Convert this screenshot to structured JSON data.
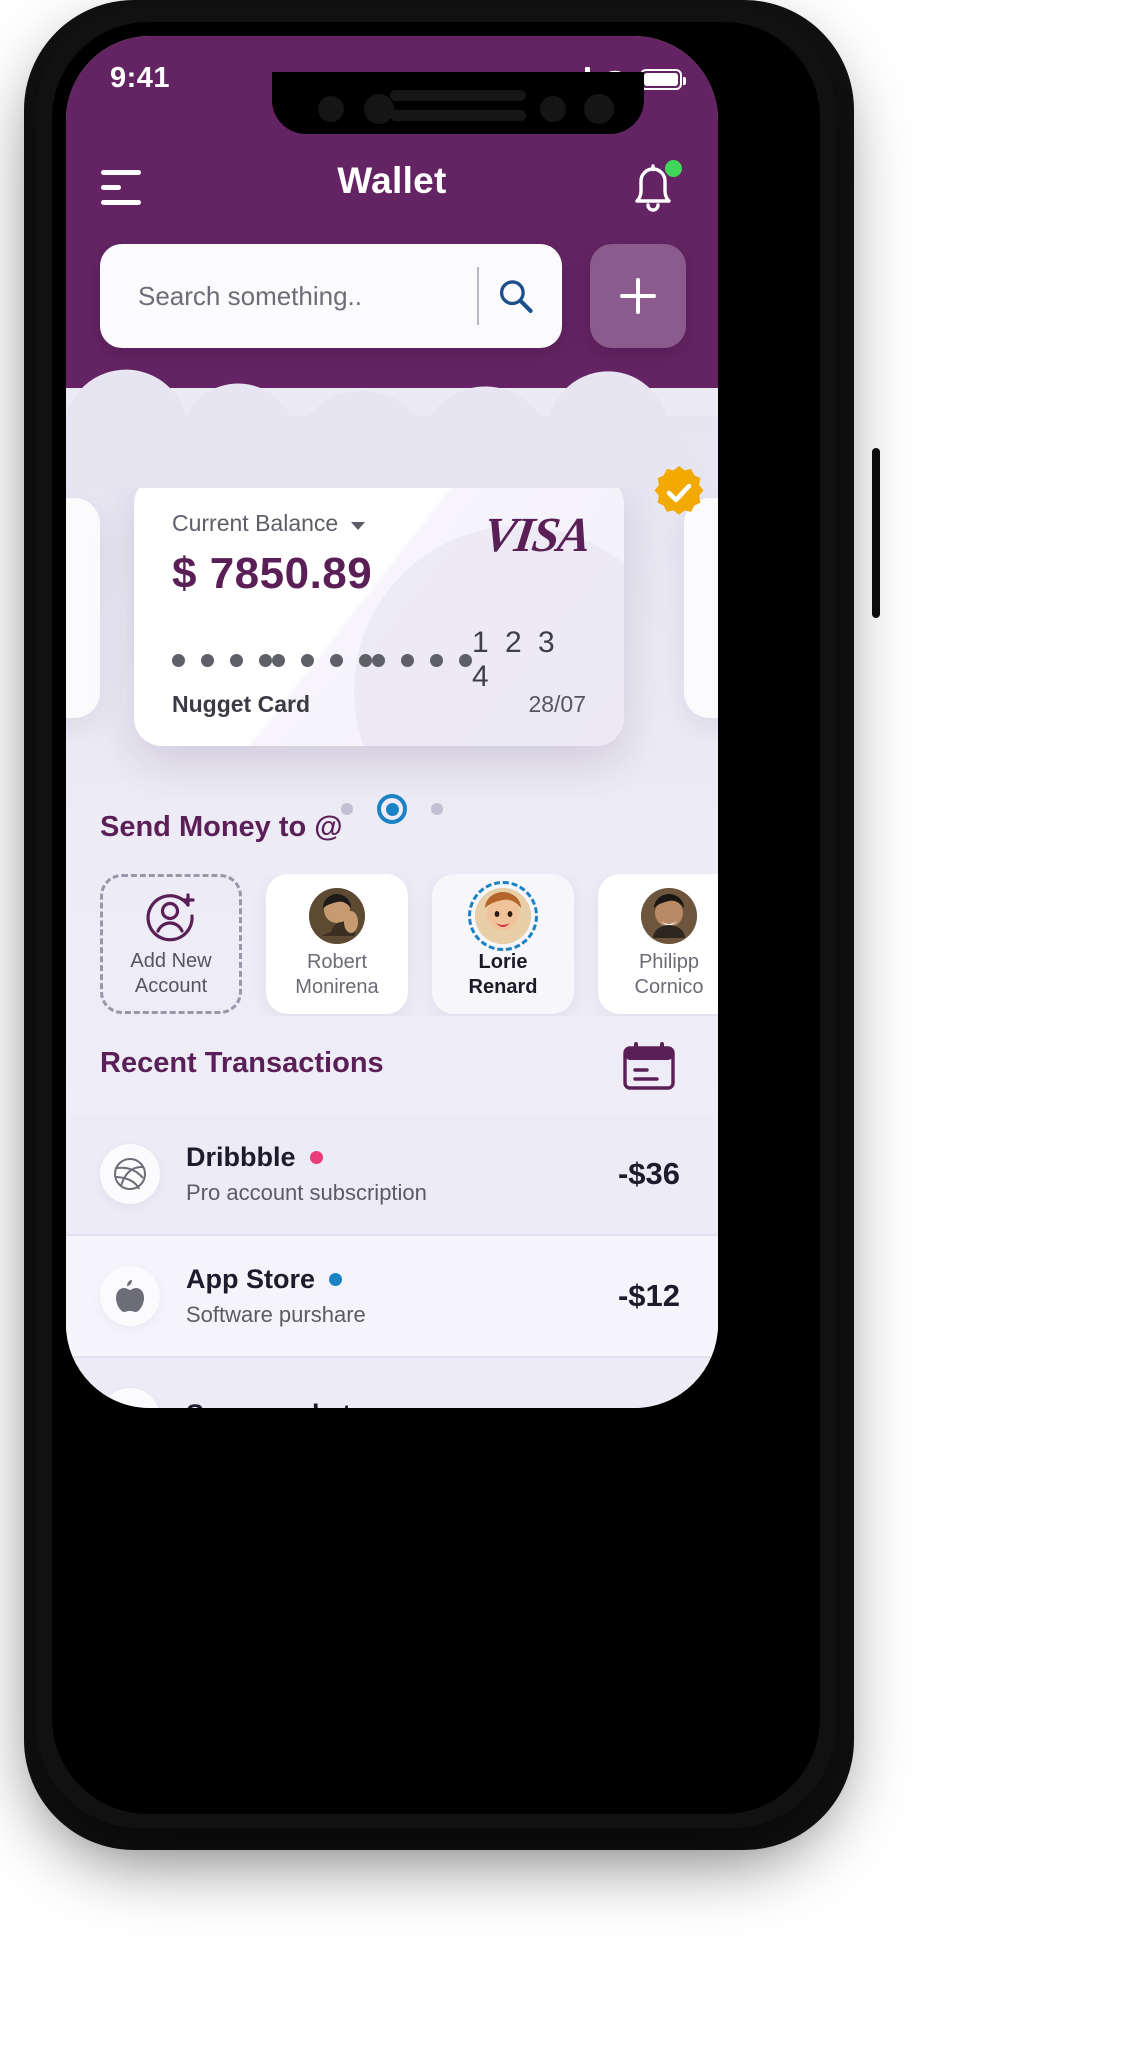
{
  "status_bar": {
    "time": "9:41",
    "signal_icon": "signal-bars-icon",
    "wifi_icon": "wifi-icon",
    "battery_icon": "battery-full-icon"
  },
  "nav": {
    "menu_icon": "hamburger-menu-icon",
    "title": "Wallet",
    "bell_icon": "notification-bell-icon",
    "has_notification": true,
    "notification_color": "#3fd659"
  },
  "search": {
    "placeholder": "Search something..",
    "value": "",
    "icon": "search-magnifier-icon"
  },
  "add_button": {
    "label": "+",
    "icon": "plus-icon"
  },
  "card": {
    "balance_label": "Current Balance",
    "chevron_icon": "chevron-down-icon",
    "balance_amount": "$ 7850.89",
    "brand": "VISA",
    "verified_icon": "verified-badge-icon",
    "masked_groups": [
      "••••",
      "••••",
      "••••"
    ],
    "last_four": "1 2 3 4",
    "card_name": "Nugget Card",
    "expiry": "28/07"
  },
  "pager": {
    "total": 3,
    "active_index": 1
  },
  "send_money": {
    "title": "Send Money to @",
    "add_new": {
      "label_line1": "Add New",
      "label_line2": "Account",
      "icon": "add-person-icon"
    },
    "contacts": [
      {
        "line1": "Robert",
        "line2": "Monirena",
        "selected": false,
        "avatar_color": "#7a5c3e"
      },
      {
        "line1": "Lorie",
        "line2": "Renard",
        "selected": true,
        "avatar_color": "#c98a5e"
      },
      {
        "line1": "Philipp",
        "line2": "Cornico",
        "selected": false,
        "avatar_color": "#6b4e38"
      }
    ]
  },
  "transactions": {
    "title": "Recent Transactions",
    "calendar_icon": "calendar-icon",
    "items": [
      {
        "name": "Dribbble",
        "sub": "Pro account subscription",
        "amount": "-$36",
        "dot_color": "#ea3c7a",
        "icon": "dribbble-icon"
      },
      {
        "name": "App Store",
        "sub": "Software purshare",
        "amount": "-$12",
        "dot_color": "#1b82c4",
        "icon": "apple-icon"
      },
      {
        "name": "Supermarket",
        "sub": "",
        "amount": "",
        "dot_color": "#3fd659",
        "icon": "cart-icon"
      }
    ]
  },
  "theme": {
    "header_purple": "#642463",
    "accent_purple": "#5b1f57",
    "accent_blue": "#1b82c4",
    "body_bg": "#eceaf5",
    "gold": "#f2a900"
  }
}
